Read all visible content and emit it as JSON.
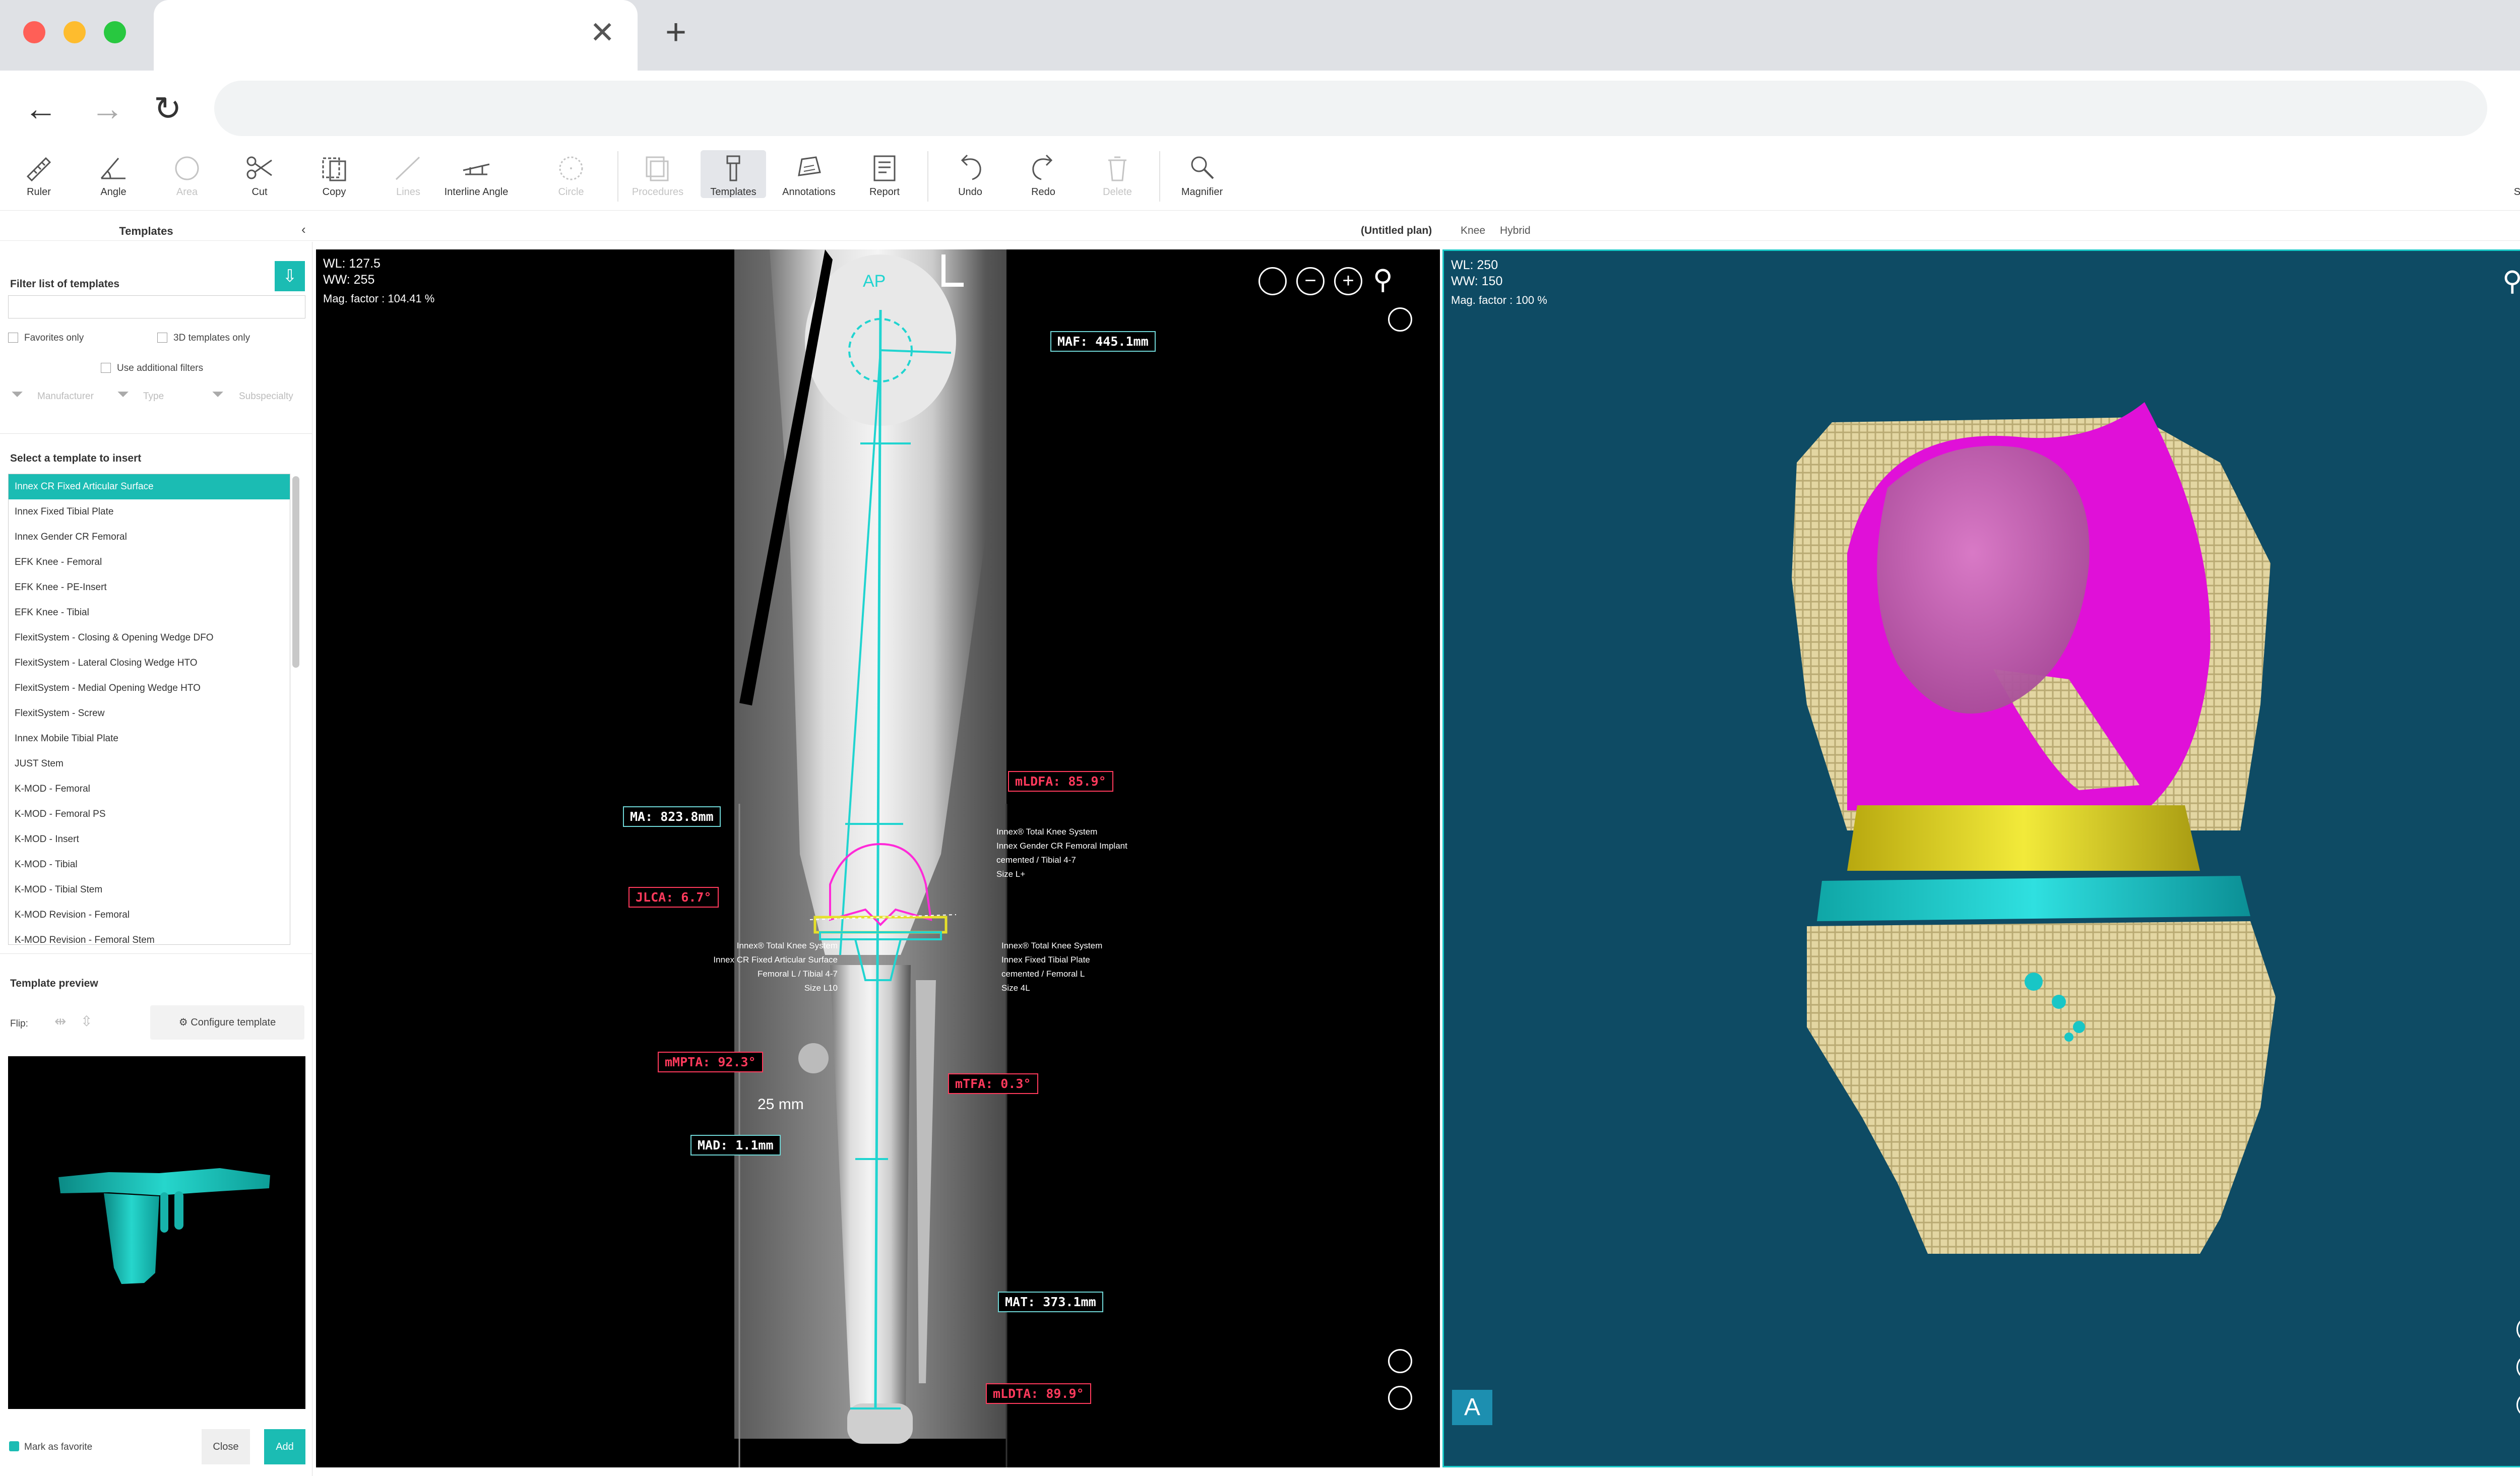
{
  "toolbar": {
    "items": [
      {
        "label": "Ruler",
        "icon": "ruler-icon",
        "enabled": true
      },
      {
        "label": "Angle",
        "icon": "angle-icon",
        "enabled": true
      },
      {
        "label": "Area",
        "icon": "area-icon",
        "enabled": false
      },
      {
        "label": "Cut",
        "icon": "scissors-icon",
        "enabled": true
      },
      {
        "label": "Copy",
        "icon": "copy-icon",
        "enabled": true
      },
      {
        "label": "Lines",
        "icon": "line-icon",
        "enabled": false
      },
      {
        "label": "Interline Angle",
        "icon": "interline-angle-icon",
        "enabled": true
      },
      {
        "label": "Circle",
        "icon": "circle-icon",
        "enabled": false
      },
      {
        "label": "Procedures",
        "icon": "procedures-icon",
        "enabled": false
      },
      {
        "label": "Templates",
        "icon": "templates-icon",
        "enabled": true,
        "active": true
      },
      {
        "label": "Annotations",
        "icon": "annotations-icon",
        "enabled": true
      },
      {
        "label": "Report",
        "icon": "report-icon",
        "enabled": true
      },
      {
        "label": "Undo",
        "icon": "undo-icon",
        "enabled": true
      },
      {
        "label": "Redo",
        "icon": "redo-icon",
        "enabled": true
      },
      {
        "label": "Delete",
        "icon": "trash-icon",
        "enabled": false
      },
      {
        "label": "Magnifier",
        "icon": "magnifier-icon",
        "enabled": true
      }
    ],
    "snapshot_label": "Snapshot"
  },
  "subbar": {
    "panel_title": "Templates",
    "plan_name": "(Untitled plan)",
    "tabs": [
      "Knee",
      "Hybrid"
    ]
  },
  "sidepanel": {
    "filter_title": "Filter list of templates",
    "favorites_only": "Favorites only",
    "templates_3d_only": "3D templates only",
    "use_additional_filters": "Use additional filters",
    "filter_manufacturer": "Manufacturer",
    "filter_type": "Type",
    "filter_subspecialty": "Subspecialty",
    "select_title": "Select a template to insert",
    "templates": [
      "Innex CR Fixed Articular Surface",
      "Innex Fixed Tibial Plate",
      "Innex Gender CR Femoral",
      "EFK Knee - Femoral",
      "EFK Knee - PE-Insert",
      "EFK Knee - Tibial",
      "FlexitSystem - Closing & Opening Wedge DFO",
      "FlexitSystem - Lateral Closing Wedge HTO",
      "FlexitSystem - Medial Opening Wedge HTO",
      "FlexitSystem - Screw",
      "Innex Mobile Tibial Plate",
      "JUST Stem",
      "K-MOD - Femoral",
      "K-MOD - Femoral PS",
      "K-MOD - Insert",
      "K-MOD - Tibial",
      "K-MOD - Tibial Stem",
      "K-MOD Revision - Femoral",
      "K-MOD Revision - Femoral Stem"
    ],
    "selected_index": 0,
    "preview_title": "Template preview",
    "flip_label": "Flip:",
    "configure_label": "Configure template",
    "mark_favorite": "Mark as favorite",
    "close_label": "Close",
    "add_label": "Add"
  },
  "xray": {
    "wl": "WL: 127.5",
    "ww": "WW: 255",
    "mag": "Mag. factor : 104.41 %",
    "orientation_letter": "L",
    "view_label": "AP",
    "scale_text": "25 mm",
    "labels": {
      "maf": "MAF: 445.1mm",
      "mldfa": "mLDFA: 85.9°",
      "ma": "MA: 823.8mm",
      "jlca": "JLCA: 6.7°",
      "mmpta": "mMPTA: 92.3°",
      "mtfa": "mTFA: 0.3°",
      "mad": "MAD: 1.1mm",
      "mat": "MAT: 373.1mm",
      "mldta": "mLDTA: 89.9°"
    },
    "notes": {
      "femoral_top": [
        "Innex® Total Knee System",
        "Innex Gender CR Femoral Implant",
        "cemented / Tibial 4-7",
        "Size L+"
      ],
      "left": [
        "Innex® Total Knee System",
        "Innex CR Fixed Articular Surface",
        "Femoral L / Tibial 4-7",
        "Size L10"
      ],
      "right": [
        "Innex® Total Knee System",
        "Innex Fixed Tibial Plate",
        "cemented / Femoral L",
        "Size 4L"
      ]
    }
  },
  "model3d": {
    "wl": "WL: 250",
    "ww": "WW: 150",
    "mag": "Mag. factor : 100 %",
    "orientation_badge": "A"
  },
  "colors": {
    "accent": "#1bbcb3",
    "measure_red": "#ff3a5c",
    "model_bg": "#0e4b64",
    "implant_magenta": "#e010d8",
    "implant_yellow": "#e6de2a",
    "implant_cyan": "#18c6c6",
    "bone": "#e5d9a8"
  }
}
